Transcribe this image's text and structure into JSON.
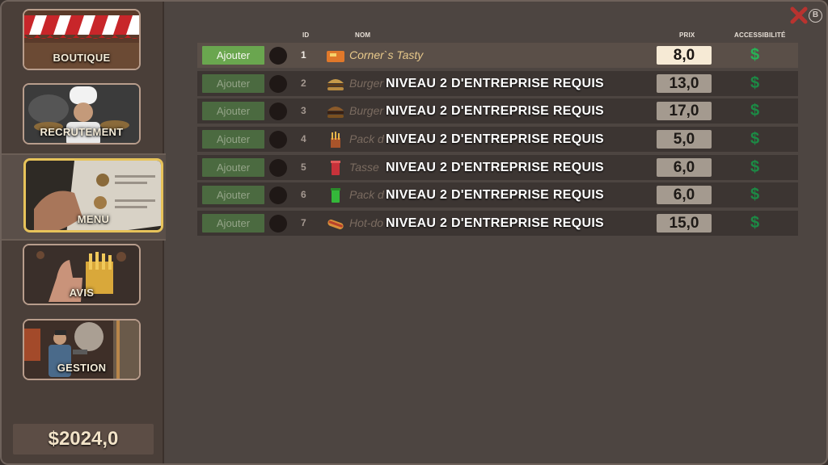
{
  "sidebar": {
    "items": [
      {
        "label": "BOUTIQUE"
      },
      {
        "label": "RECRUTEMENT"
      },
      {
        "label": "MENU"
      },
      {
        "label": "AVIS"
      },
      {
        "label": "GESTION"
      }
    ],
    "money": "$2024,0"
  },
  "close": {
    "badge": "B"
  },
  "table": {
    "headers": {
      "id": "ID",
      "name": "NOM",
      "price": "PRIX",
      "access": "ACCESSIBILITÉ"
    },
    "rows": [
      {
        "button": "Ajouter",
        "id": "1",
        "name": "Corner`s Tasty",
        "overlay": "",
        "price": "8,0",
        "access": "$",
        "icon": "box-icon"
      },
      {
        "button": "Ajouter",
        "id": "2",
        "name": "Burger",
        "overlay": "NIVEAU 2 D'ENTREPRISE REQUIS",
        "price": "13,0",
        "access": "$",
        "icon": "burger-icon"
      },
      {
        "button": "Ajouter",
        "id": "3",
        "name": "Burger",
        "overlay": "NIVEAU 2 D'ENTREPRISE REQUIS",
        "price": "17,0",
        "access": "$",
        "icon": "burger-icon"
      },
      {
        "button": "Ajouter",
        "id": "4",
        "name": "Pack d",
        "overlay": "NIVEAU 2 D'ENTREPRISE REQUIS",
        "price": "5,0",
        "access": "$",
        "icon": "fries-icon"
      },
      {
        "button": "Ajouter",
        "id": "5",
        "name": "Tasse",
        "overlay": "NIVEAU 2 D'ENTREPRISE REQUIS",
        "price": "6,0",
        "access": "$",
        "icon": "cup-icon"
      },
      {
        "button": "Ajouter",
        "id": "6",
        "name": "Pack d",
        "overlay": "NIVEAU 2 D'ENTREPRISE REQUIS",
        "price": "6,0",
        "access": "$",
        "icon": "drink-icon"
      },
      {
        "button": "Ajouter",
        "id": "7",
        "name": "Hot-do",
        "overlay": "NIVEAU 2 D'ENTREPRISE REQUIS",
        "price": "15,0",
        "access": "$",
        "icon": "hotdog-icon"
      }
    ]
  }
}
